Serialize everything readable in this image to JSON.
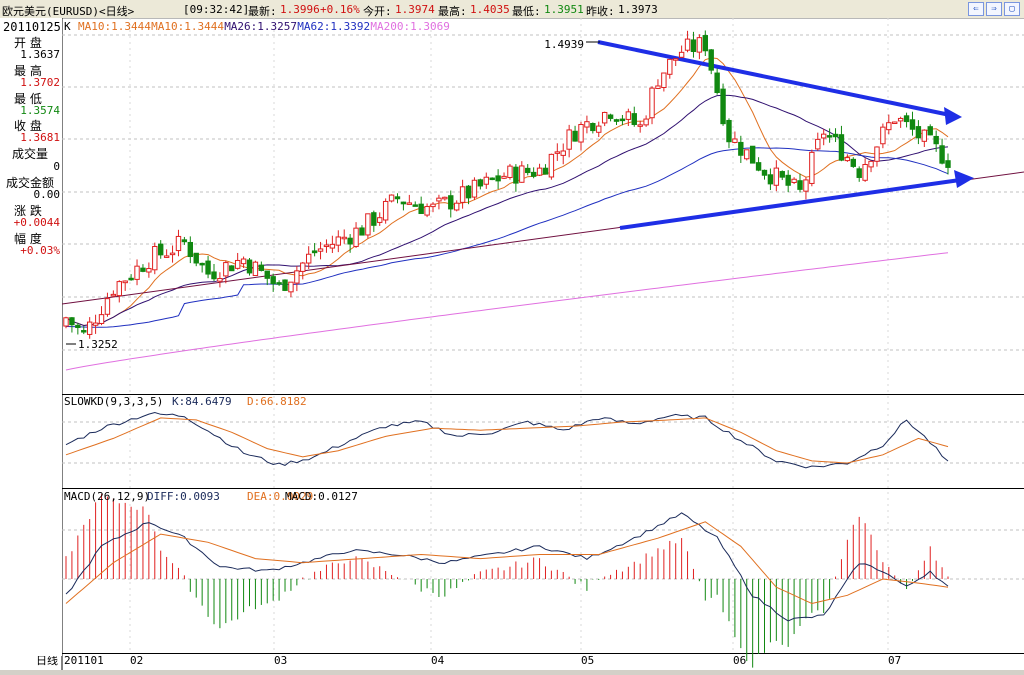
{
  "titlebar": {
    "instrument": "欧元美元(EURUSD)<日线>",
    "time": "[09:32:42]",
    "latest_label": "最新:",
    "latest_value": "1.3996",
    "change": "+0.16%",
    "open_label": "今开:",
    "open_value": "1.3974",
    "high_label": "最高:",
    "high_value": "1.4035",
    "low_label": "最低:",
    "low_value": "1.3951",
    "prev_label": "昨收:",
    "prev_value": "1.3973"
  },
  "side": {
    "date": "20110125",
    "open_label": "开 盘",
    "open_value": "1.3637",
    "high_label": "最 高",
    "high_value": "1.3702",
    "low_label": "最 低",
    "low_value": "1.3574",
    "close_label": "收 盘",
    "close_value": "1.3681",
    "volume_label": "成交量",
    "volume_value": "0",
    "amount_label": "成交金额",
    "amount_value": "0.00",
    "change_label": "涨 跌",
    "change_value": "+0.0044",
    "range_label": "幅 度",
    "range_value": "+0.03%"
  },
  "colors": {
    "up": "#e02020",
    "down": "#118811",
    "ma10": "#e07020",
    "ma26": "#301070",
    "ma62": "#2030c0",
    "ma200": "#e070e0",
    "trend": "#1e2ee6",
    "grid": "#c0c0c0"
  },
  "chart_data": [
    {
      "type": "candlestick",
      "title": "K",
      "legend": [
        {
          "label": "MA10:1.3444",
          "color": "#e07020"
        },
        {
          "label": "MA10:1.3444",
          "color": "#e07020"
        },
        {
          "label": "MA26:1.3257",
          "color": "#301070"
        },
        {
          "label": "MA62:1.3392",
          "color": "#2030c0"
        },
        {
          "label": "MA200:1.3069",
          "color": "#e070e0"
        }
      ],
      "yticks": [
        "1.35",
        "1.32"
      ],
      "ylim": [
        1.295,
        1.5
      ],
      "annotations": [
        {
          "text": "1.4939",
          "value": 1.4939
        },
        {
          "text": "1.3252",
          "value": 1.3252
        }
      ],
      "x_labels": [
        "201101",
        "02",
        "03",
        "04",
        "05",
        "06",
        "07"
      ],
      "x_axis_label": "日线"
    },
    {
      "type": "line",
      "title": "SLOWKD(9,3,3,5)",
      "legend": [
        {
          "label": "K:84.6479",
          "color": "#1a2a5a"
        },
        {
          "label": "D:66.8182",
          "color": "#e07020"
        }
      ],
      "yticks": [
        "80",
        "40"
      ],
      "ylim": [
        20,
        100
      ]
    },
    {
      "type": "bar",
      "title": "MACD(26,12,9)",
      "legend": [
        {
          "label": "DIFF:0.0093",
          "color": "#1a2a5a"
        },
        {
          "label": "DEA:0.0029",
          "color": "#e07020"
        },
        {
          "label": "MACD:0.0127",
          "color": "#000000"
        }
      ],
      "yticks": [
        "0.012",
        "0"
      ],
      "ylim": [
        -0.012,
        0.022
      ]
    }
  ]
}
